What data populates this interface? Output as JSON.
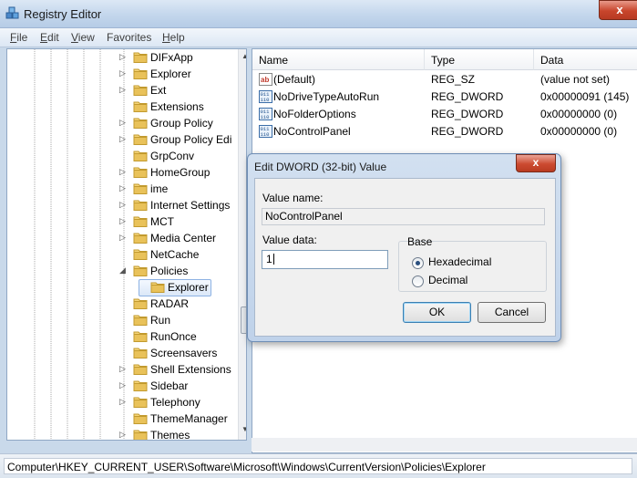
{
  "window": {
    "title": "Registry Editor",
    "close_glyph": "x"
  },
  "menu": [
    {
      "key": "F",
      "rest": "ile"
    },
    {
      "key": "E",
      "rest": "dit"
    },
    {
      "key": "V",
      "rest": "iew"
    },
    {
      "key": "",
      "rest": "Favorites"
    },
    {
      "key": "H",
      "rest": "elp"
    }
  ],
  "tree": {
    "items": [
      {
        "label": "DIFxApp",
        "expander": "▷"
      },
      {
        "label": "Explorer",
        "expander": "▷"
      },
      {
        "label": "Ext",
        "expander": "▷"
      },
      {
        "label": "Extensions",
        "expander": ""
      },
      {
        "label": "Group Policy",
        "expander": "▷"
      },
      {
        "label": "Group Policy Edi",
        "expander": "▷"
      },
      {
        "label": "GrpConv",
        "expander": ""
      },
      {
        "label": "HomeGroup",
        "expander": "▷"
      },
      {
        "label": "ime",
        "expander": "▷"
      },
      {
        "label": "Internet Settings",
        "expander": "▷"
      },
      {
        "label": "MCT",
        "expander": "▷"
      },
      {
        "label": "Media Center",
        "expander": "▷"
      },
      {
        "label": "NetCache",
        "expander": ""
      },
      {
        "label": "Policies",
        "expander": "◢"
      },
      {
        "label": "Explorer",
        "expander": "",
        "child": true,
        "selected": true
      },
      {
        "label": "RADAR",
        "expander": ""
      },
      {
        "label": "Run",
        "expander": ""
      },
      {
        "label": "RunOnce",
        "expander": ""
      },
      {
        "label": "Screensavers",
        "expander": ""
      },
      {
        "label": "Shell Extensions",
        "expander": "▷"
      },
      {
        "label": "Sidebar",
        "expander": "▷"
      },
      {
        "label": "Telephony",
        "expander": "▷"
      },
      {
        "label": "ThemeManager",
        "expander": ""
      },
      {
        "label": "Themes",
        "expander": "▷"
      }
    ]
  },
  "list": {
    "columns": [
      "Name",
      "Type",
      "Data"
    ],
    "rows": [
      {
        "icon": "string-value-icon",
        "name": "(Default)",
        "type": "REG_SZ",
        "data": "(value not set)"
      },
      {
        "icon": "binary-value-icon",
        "name": "NoDriveTypeAutoRun",
        "type": "REG_DWORD",
        "data": "0x00000091 (145)"
      },
      {
        "icon": "binary-value-icon",
        "name": "NoFolderOptions",
        "type": "REG_DWORD",
        "data": "0x00000000 (0)"
      },
      {
        "icon": "binary-value-icon",
        "name": "NoControlPanel",
        "type": "REG_DWORD",
        "data": "0x00000000 (0)"
      }
    ]
  },
  "dialog": {
    "title": "Edit DWORD (32-bit) Value",
    "value_name_label": "Value name:",
    "value_name": "NoControlPanel",
    "value_data_label": "Value data:",
    "value_data": "1",
    "base_label": "Base",
    "hex_label": "Hexadecimal",
    "dec_label": "Decimal",
    "selected_base": "Hexadecimal",
    "ok_label": "OK",
    "cancel_label": "Cancel",
    "close_glyph": "x"
  },
  "status": {
    "path": "Computer\\HKEY_CURRENT_USER\\Software\\Microsoft\\Windows\\CurrentVersion\\Policies\\Explorer"
  },
  "colors": {
    "folder": "#e9c25a",
    "selection_border": "#8db2e3",
    "accent": "#3c7fb1"
  }
}
